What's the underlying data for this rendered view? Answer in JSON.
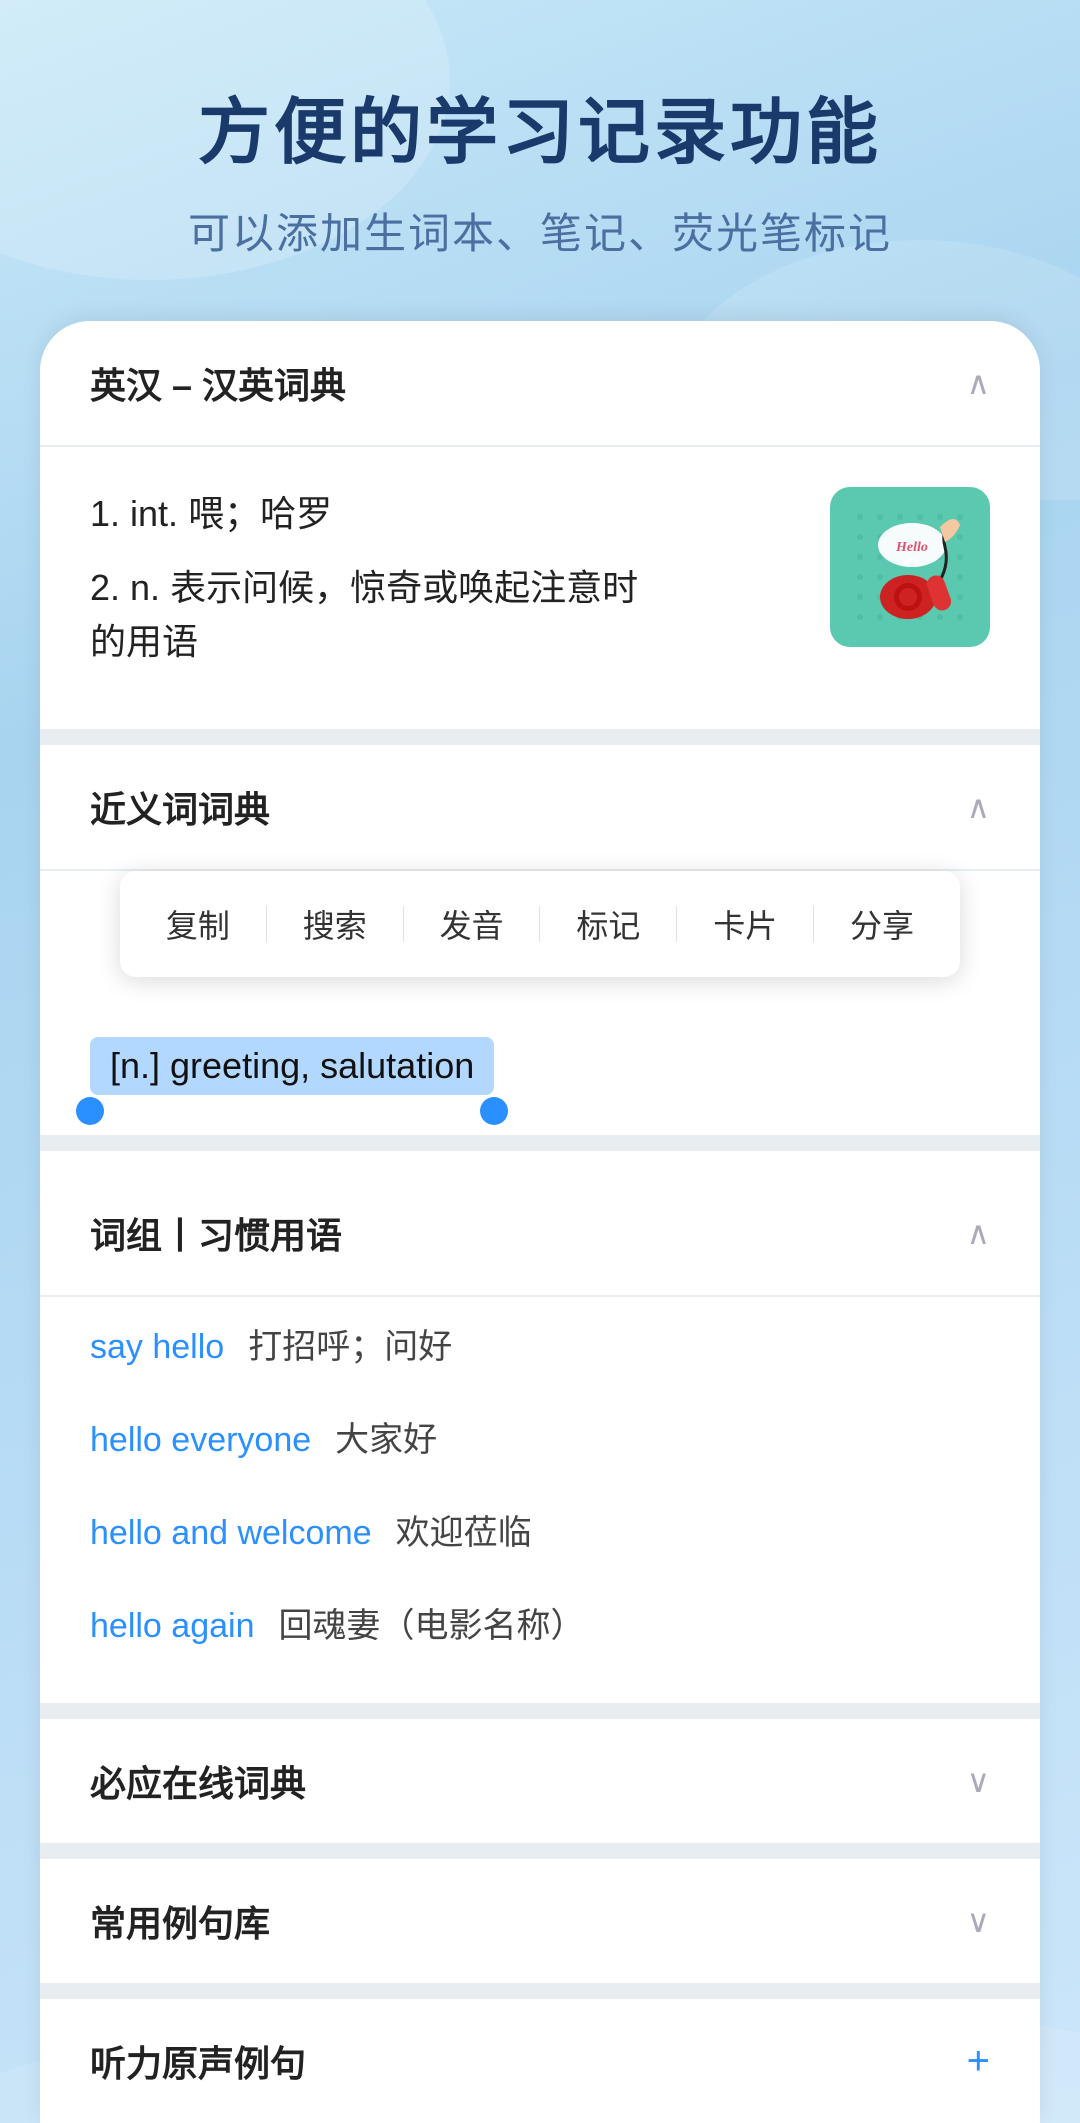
{
  "header": {
    "title": "方便的学习记录功能",
    "subtitle": "可以添加生词本、笔记、荧光笔标记"
  },
  "sections": {
    "dictionary": {
      "title": "英汉 – 汉英词典",
      "chevron": "∧",
      "definitions": [
        {
          "index": "1.",
          "type": "int.",
          "text": "喂；哈罗"
        },
        {
          "index": "2.",
          "type": "n.",
          "text": "表示问候，惊奇或唤起注意时的用语"
        }
      ]
    },
    "synonym": {
      "title": "近义词词典",
      "chevron": "∧",
      "context_menu": {
        "items": [
          "复制",
          "搜索",
          "发音",
          "标记",
          "卡片",
          "分享"
        ]
      },
      "highlighted": "[n.] greeting, salutation"
    },
    "phrases": {
      "title": "词组丨习惯用语",
      "chevron": "∧",
      "items": [
        {
          "en": "say hello",
          "zh": "打招呼；问好"
        },
        {
          "en": "hello everyone",
          "zh": "大家好"
        },
        {
          "en": "hello and welcome",
          "zh": "欢迎莅临"
        },
        {
          "en": "hello again",
          "zh": "回魂妻（电影名称）"
        }
      ]
    },
    "byying": {
      "title": "必应在线词典",
      "chevron": "∨"
    },
    "examples": {
      "title": "常用例句库",
      "chevron": "∨"
    },
    "audio": {
      "title": "听力原声例句",
      "plus": "+"
    }
  },
  "colors": {
    "accent": "#2b90ff",
    "title_dark": "#1a3a6b",
    "subtitle": "#4a6fa0",
    "section_bg": "#f0f4f8",
    "divider": "#e8edf2",
    "highlight": "#b3d8ff"
  }
}
